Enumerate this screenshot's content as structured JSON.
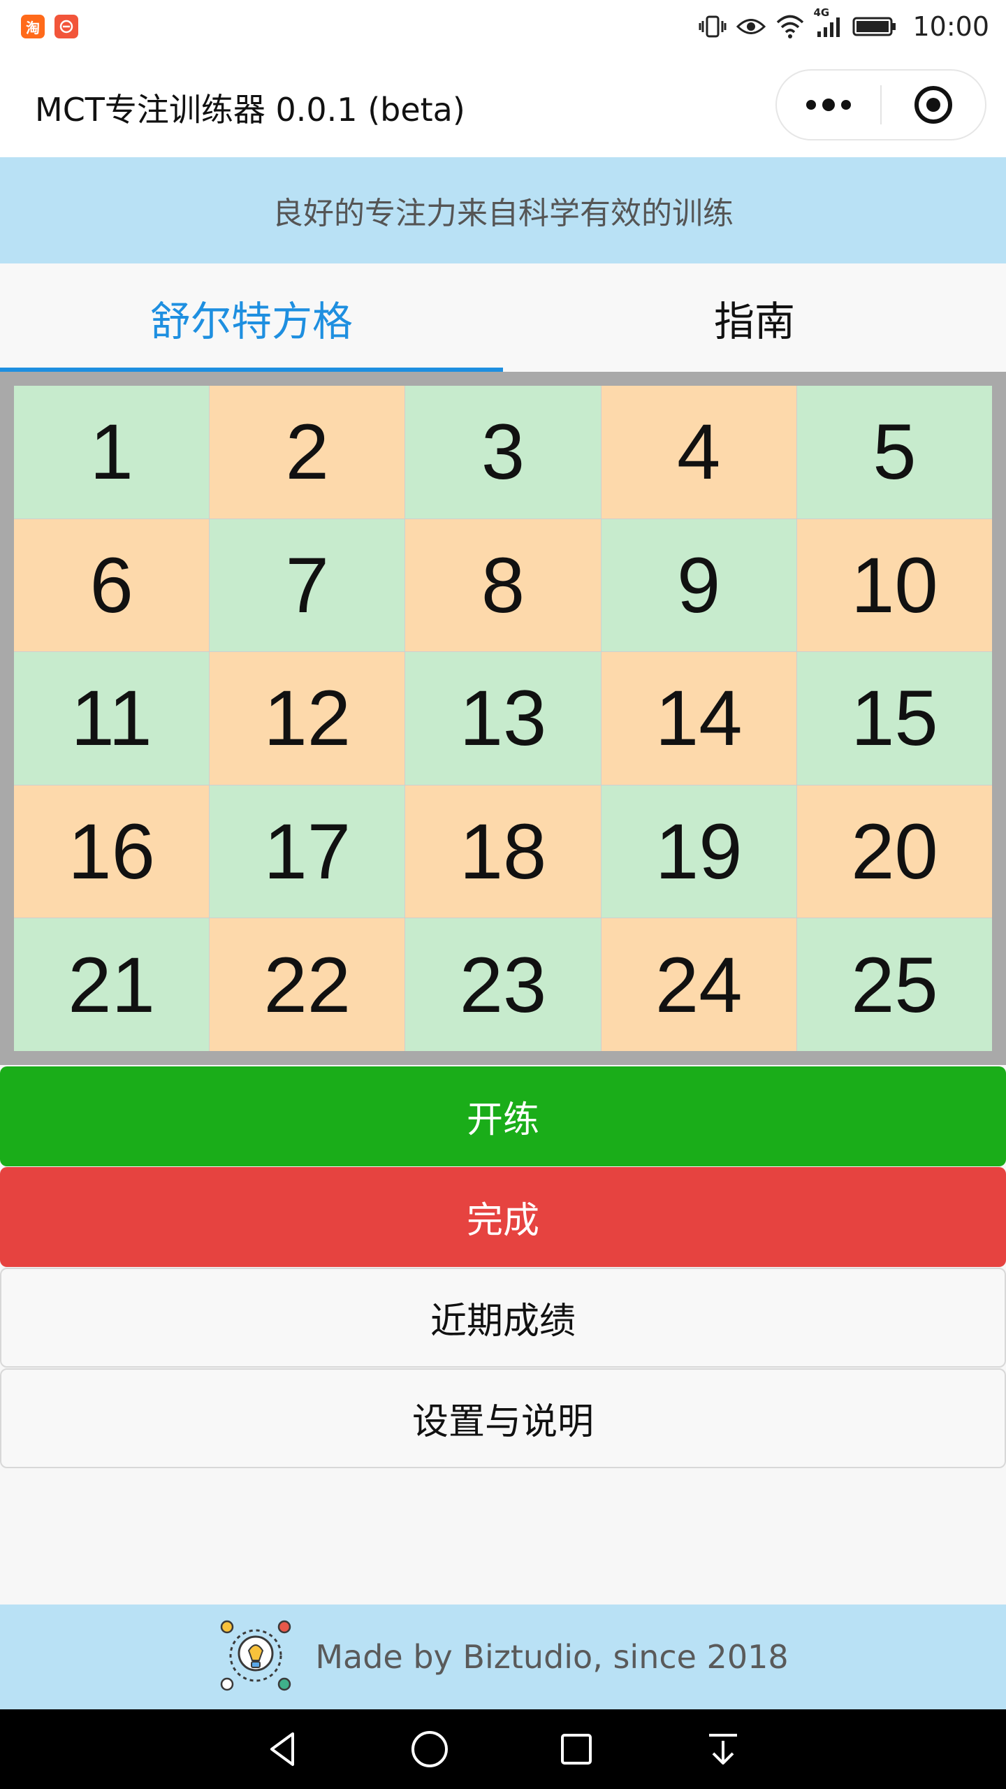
{
  "status_bar": {
    "time": "10:00",
    "network": "4G",
    "left_icons": [
      "taobao-app-icon",
      "notification-app-icon"
    ],
    "right_icons": [
      "vibrate-icon",
      "eye-icon",
      "wifi-icon",
      "signal-icon",
      "battery-icon"
    ]
  },
  "title_bar": {
    "title": "MCT专注训练器 0.0.1 (beta)"
  },
  "banner": {
    "text": "良好的专注力来自科学有效的训练"
  },
  "tabs": [
    {
      "label": "舒尔特方格",
      "active": true
    },
    {
      "label": "指南",
      "active": false
    }
  ],
  "grid": {
    "rows": [
      [
        "1",
        "2",
        "3",
        "4",
        "5"
      ],
      [
        "6",
        "7",
        "8",
        "9",
        "10"
      ],
      [
        "11",
        "12",
        "13",
        "14",
        "15"
      ],
      [
        "16",
        "17",
        "18",
        "19",
        "20"
      ],
      [
        "21",
        "22",
        "23",
        "24",
        "25"
      ]
    ],
    "colors": {
      "green": "#c7ebcd",
      "orange": "#fdd9ab"
    }
  },
  "buttons": {
    "start": "开练",
    "finish": "完成",
    "history": "近期成绩",
    "settings": "设置与说明"
  },
  "colors": {
    "accent": "#1e8fe0",
    "start_button": "#1aad19",
    "finish_button": "#e64340",
    "banner_bg": "#b9e1f5"
  },
  "footer": {
    "text": "Made by Biztudio, since 2018"
  }
}
